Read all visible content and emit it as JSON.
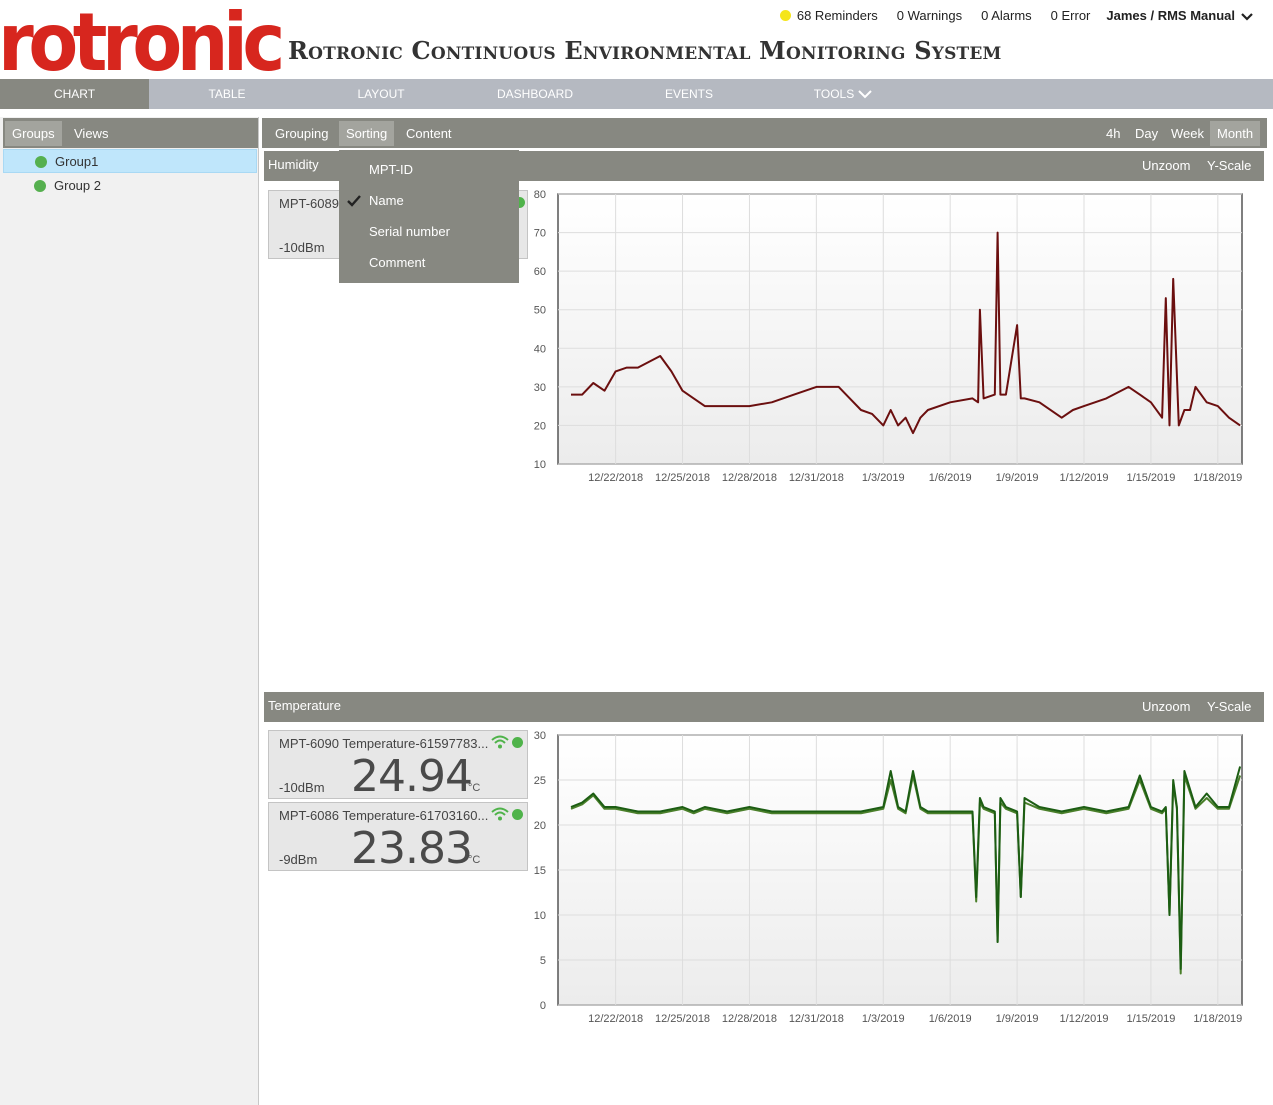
{
  "header": {
    "logo_text": "rotronic",
    "title": "Rotronic Continuous Environmental Monitoring System",
    "reminders": "68 Reminders",
    "warnings": "0 Warnings",
    "alarms": "0 Alarms",
    "errors": "0 Error",
    "user": "James / RMS Manual",
    "reminder_color": "#f5e51a"
  },
  "nav": {
    "items": [
      "CHART",
      "TABLE",
      "LAYOUT",
      "DASHBOARD",
      "EVENTS",
      "TOOLS"
    ],
    "active": "CHART"
  },
  "sidebar": {
    "tabs": [
      "Groups",
      "Views"
    ],
    "active_tab": "Groups",
    "groups": [
      {
        "label": "Group1",
        "selected": true
      },
      {
        "label": "Group 2",
        "selected": false
      }
    ]
  },
  "toolbar": {
    "left_tabs": [
      "Grouping",
      "Sorting",
      "Content"
    ],
    "active_left": "Sorting",
    "range_tabs": [
      "4h",
      "Day",
      "Week",
      "Month"
    ],
    "active_range": "Month"
  },
  "sort_menu": {
    "items": [
      "MPT-ID",
      "Name",
      "Serial number",
      "Comment"
    ],
    "checked": "Name"
  },
  "humidity": {
    "title": "Humidity",
    "unzoom": "Unzoom",
    "yscale": "Y-Scale",
    "sensor": {
      "name": "MPT-6089",
      "signal": "-10dBm"
    }
  },
  "temperature": {
    "title": "Temperature",
    "unzoom": "Unzoom",
    "yscale": "Y-Scale",
    "sensors": [
      {
        "name": "MPT-6090 Temperature-61597783...",
        "signal": "-10dBm",
        "value": "24.94",
        "unit": "°C"
      },
      {
        "name": "MPT-6086 Temperature-61703160...",
        "signal": "-9dBm",
        "value": "23.83",
        "unit": "°C"
      }
    ]
  },
  "chart_data": [
    {
      "type": "line",
      "title": "Humidity",
      "x_tick_labels": [
        "12/22/2018",
        "12/25/2018",
        "12/28/2018",
        "12/31/2018",
        "1/3/2019",
        "1/6/2019",
        "1/9/2019",
        "1/12/2019",
        "1/15/2019",
        "1/18/2019"
      ],
      "ylim": [
        10,
        80
      ],
      "y_ticks": [
        10,
        20,
        30,
        40,
        50,
        60,
        70,
        80
      ],
      "color": "#6b0f0f",
      "x": [
        "12/20/2018",
        "12/20/2018 12:00",
        "12/21/2018",
        "12/21/2018 12:00",
        "12/22/2018",
        "12/22/2018 12:00",
        "12/23/2018",
        "12/24/2018",
        "12/24/2018 12:00",
        "12/25/2018",
        "12/25/2018 12:00",
        "12/26/2018",
        "12/27/2018",
        "12/28/2018",
        "12/29/2018",
        "12/30/2018",
        "12/31/2018",
        "1/1/2019",
        "1/1/2019 12:00",
        "1/2/2019",
        "1/2/2019 12:00",
        "1/3/2019",
        "1/3/2019 08:00",
        "1/3/2019 16:00",
        "1/4/2019",
        "1/4/2019 08:00",
        "1/4/2019 16:00",
        "1/5/2019",
        "1/6/2019",
        "1/7/2019",
        "1/7/2019 06:00",
        "1/7/2019 08:00",
        "1/7/2019 12:00",
        "1/8/2019",
        "1/8/2019 03:00",
        "1/8/2019 06:00",
        "1/8/2019 12:00",
        "1/9/2019",
        "1/9/2019 04:00",
        "1/9/2019 08:00",
        "1/10/2019",
        "1/11/2019",
        "1/11/2019 12:00",
        "1/12/2019",
        "1/13/2019",
        "1/14/2019",
        "1/14/2019 12:00",
        "1/15/2019",
        "1/15/2019 12:00",
        "1/15/2019 16:00",
        "1/15/2019 20:00",
        "1/16/2019",
        "1/16/2019 06:00",
        "1/16/2019 12:00",
        "1/16/2019 18:00",
        "1/17/2019",
        "1/17/2019 12:00",
        "1/18/2019",
        "1/18/2019 12:00",
        "1/19/2019"
      ],
      "y": [
        28,
        28,
        31,
        29,
        34,
        35,
        35,
        38,
        34,
        29,
        27,
        25,
        25,
        25,
        26,
        28,
        30,
        30,
        27,
        24,
        23,
        20,
        24,
        20,
        22,
        18,
        22,
        24,
        26,
        27,
        26,
        50,
        27,
        28,
        70,
        28,
        28,
        46,
        27,
        27,
        26,
        22,
        24,
        25,
        27,
        30,
        28,
        26,
        22,
        53,
        20,
        58,
        20,
        24,
        24,
        30,
        26,
        25,
        22,
        20
      ],
      "series": [
        {
          "name": "MPT-6089"
        }
      ]
    },
    {
      "type": "line",
      "title": "Temperature",
      "x_tick_labels": [
        "12/22/2018",
        "12/25/2018",
        "12/28/2018",
        "12/31/2018",
        "1/3/2019",
        "1/6/2019",
        "1/9/2019",
        "1/12/2019",
        "1/15/2019",
        "1/18/2019"
      ],
      "ylim": [
        0,
        30
      ],
      "y_ticks": [
        0,
        5,
        10,
        15,
        20,
        25,
        30
      ],
      "colors": [
        "#1c5d13",
        "#4a7f2a"
      ],
      "x": [
        "12/20/2018",
        "12/20/2018 12:00",
        "12/21/2018",
        "12/21/2018 12:00",
        "12/22/2018",
        "12/23/2018",
        "12/24/2018",
        "12/25/2018",
        "12/25/2018 12:00",
        "12/26/2018",
        "12/27/2018",
        "12/28/2018",
        "12/29/2018",
        "12/30/2018",
        "12/31/2018",
        "1/1/2019",
        "1/2/2019",
        "1/3/2019",
        "1/3/2019 08:00",
        "1/3/2019 16:00",
        "1/4/2019",
        "1/4/2019 08:00",
        "1/4/2019 16:00",
        "1/5/2019",
        "1/6/2019",
        "1/7/2019",
        "1/7/2019 04:00",
        "1/7/2019 08:00",
        "1/7/2019 12:00",
        "1/8/2019",
        "1/8/2019 03:00",
        "1/8/2019 06:00",
        "1/8/2019 12:00",
        "1/9/2019",
        "1/9/2019 04:00",
        "1/9/2019 08:00",
        "1/10/2019",
        "1/11/2019",
        "1/12/2019",
        "1/13/2019",
        "1/14/2019",
        "1/14/2019 12:00",
        "1/15/2019",
        "1/15/2019 12:00",
        "1/15/2019 16:00",
        "1/15/2019 20:00",
        "1/16/2019",
        "1/16/2019 04:00",
        "1/16/2019 08:00",
        "1/16/2019 12:00",
        "1/17/2019",
        "1/17/2019 12:00",
        "1/18/2019",
        "1/18/2019 12:00",
        "1/19/2019"
      ],
      "series": [
        {
          "name": "MPT-6090 Temperature-61597783...",
          "y": [
            22,
            22.5,
            23.5,
            22,
            22,
            21.5,
            21.5,
            22,
            21.5,
            22,
            21.5,
            22,
            21.5,
            21.5,
            21.5,
            21.5,
            21.5,
            22,
            26,
            22,
            21.5,
            26,
            22,
            21.5,
            21.5,
            21.5,
            12,
            23,
            22,
            21.5,
            7,
            23,
            22,
            21.5,
            12,
            23,
            22,
            21.5,
            22,
            21.5,
            22,
            25.5,
            22,
            21.5,
            22,
            10,
            25,
            22,
            4,
            26,
            22,
            23.5,
            22,
            22,
            26.5
          ]
        },
        {
          "name": "MPT-6086 Temperature-61703160...",
          "y": [
            21.8,
            22.3,
            23.3,
            21.8,
            21.8,
            21.3,
            21.3,
            21.8,
            21.3,
            21.8,
            21.3,
            21.8,
            21.3,
            21.3,
            21.3,
            21.3,
            21.3,
            21.8,
            25,
            21.8,
            21.3,
            25.5,
            21.8,
            21.3,
            21.3,
            21.3,
            11.5,
            22.5,
            21.8,
            21.3,
            7,
            22.5,
            21.8,
            21.3,
            12,
            22.5,
            21.8,
            21.3,
            21.8,
            21.3,
            21.8,
            25,
            21.8,
            21.3,
            21.8,
            10,
            24.5,
            21.8,
            3.5,
            25.5,
            21.8,
            23,
            21.8,
            21.8,
            25.5
          ]
        }
      ]
    }
  ]
}
